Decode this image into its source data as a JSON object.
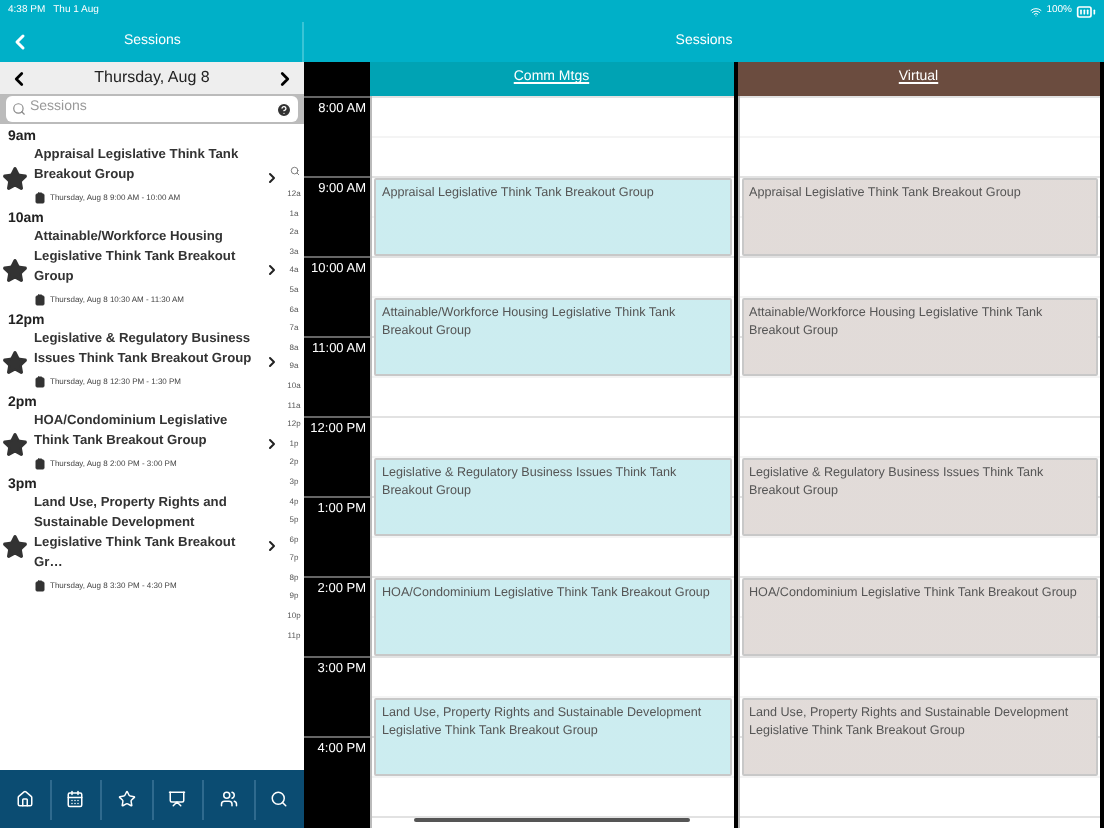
{
  "status_bar": {
    "time": "4:38 PM",
    "date": "Thu 1 Aug",
    "battery": "100%"
  },
  "left_header": {
    "title": "Sessions"
  },
  "right_header": {
    "title": "Sessions"
  },
  "date_nav": {
    "label": "Thursday, Aug 8"
  },
  "search": {
    "placeholder": "Sessions"
  },
  "sessions": [
    {
      "time": "9am",
      "title": "Appraisal Legislative Think Tank Breakout Group",
      "when": "Thursday, Aug 8 9:00 AM - 10:00 AM"
    },
    {
      "time": "10am",
      "title": "Attainable/Workforce Housing Legislative Think Tank Breakout Group",
      "when": "Thursday, Aug 8 10:30 AM - 11:30 AM"
    },
    {
      "time": "12pm",
      "title": "Legislative & Regulatory Business Issues Think Tank Breakout Group",
      "when": "Thursday, Aug 8 12:30 PM - 1:30 PM"
    },
    {
      "time": "2pm",
      "title": "HOA/Condominium Legislative Think Tank Breakout Group",
      "when": "Thursday, Aug 8 2:00 PM - 3:00 PM"
    },
    {
      "time": "3pm",
      "title": "Land Use, Property Rights and Sustainable Development Legislative Think Tank Breakout Gr…",
      "when": "Thursday, Aug 8 3:30 PM - 4:30 PM"
    }
  ],
  "index": [
    "12a",
    "1a",
    "2a",
    "3a",
    "4a",
    "5a",
    "6a",
    "7a",
    "8a",
    "9a",
    "10a",
    "11a",
    "12p",
    "1p",
    "2p",
    "3p",
    "4p",
    "5p",
    "6p",
    "7p",
    "8p",
    "9p",
    "10p",
    "11p"
  ],
  "hours": [
    "8:00 AM",
    "9:00 AM",
    "10:00 AM",
    "11:00 AM",
    "12:00 PM",
    "1:00 PM",
    "2:00 PM",
    "3:00 PM",
    "4:00 PM"
  ],
  "columns": [
    {
      "name": "Comm Mtgs",
      "color": "#00a3b4",
      "events": [
        "Appraisal Legislative Think Tank Breakout Group",
        "Attainable/Workforce Housing Legislative Think Tank Breakout Group",
        "Legislative & Regulatory Business Issues Think Tank Breakout Group",
        "HOA/Condominium Legislative Think Tank Breakout Group",
        "Land Use, Property Rights and Sustainable Development Legislative Think Tank Breakout Group"
      ]
    },
    {
      "name": "Virtual",
      "color": "#6b4c3f",
      "events": [
        "Appraisal Legislative Think Tank Breakout Group",
        "Attainable/Workforce Housing Legislative Think Tank Breakout Group",
        "Legislative & Regulatory Business Issues Think Tank Breakout Group",
        "HOA/Condominium Legislative Think Tank Breakout Group",
        "Land Use, Property Rights and Sustainable Development Legislative Think Tank Breakout Group"
      ]
    }
  ]
}
